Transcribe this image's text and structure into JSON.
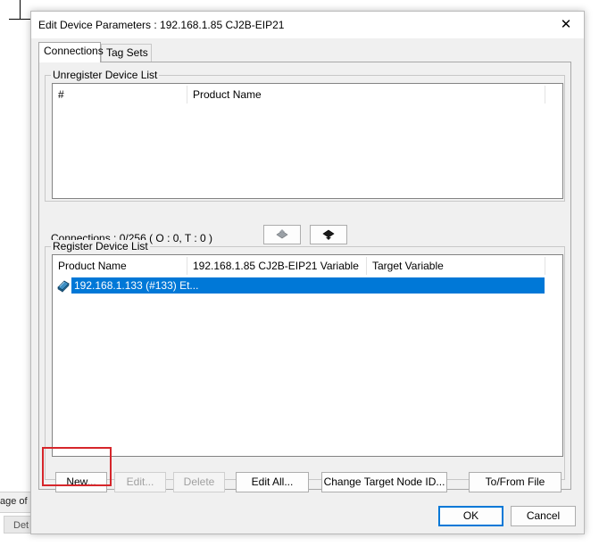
{
  "background": {
    "left_text": "age of l",
    "tab_text": "Det"
  },
  "dialog": {
    "title": "Edit Device Parameters : 192.168.1.85 CJ2B-EIP21",
    "close_glyph": "✕"
  },
  "tabs": [
    {
      "label": "Connections",
      "active": true
    },
    {
      "label": "Tag Sets",
      "active": false
    }
  ],
  "unregister": {
    "group_label": "Unregister Device List",
    "columns": [
      "#",
      "Product Name"
    ]
  },
  "connections_text": "Connections :  0/256 ( O : 0, T : 0 )",
  "register": {
    "group_label": "Register Device List",
    "columns": [
      "Product Name",
      "192.168.1.85 CJ2B-EIP21 Variable",
      "Target Variable"
    ],
    "rows": [
      {
        "product": "192.168.1.133 (#133) Et...",
        "variable": "",
        "target": "",
        "selected": true
      }
    ]
  },
  "buttons": {
    "new": "New...",
    "edit": "Edit...",
    "delete": "Delete",
    "edit_all": "Edit All...",
    "change_target": "Change Target Node ID...",
    "to_from_file": "To/From File",
    "ok": "OK",
    "cancel": "Cancel"
  },
  "colors": {
    "selection": "#0078d7",
    "highlight_box": "#d6262b",
    "default_button_border": "#0078d7"
  }
}
